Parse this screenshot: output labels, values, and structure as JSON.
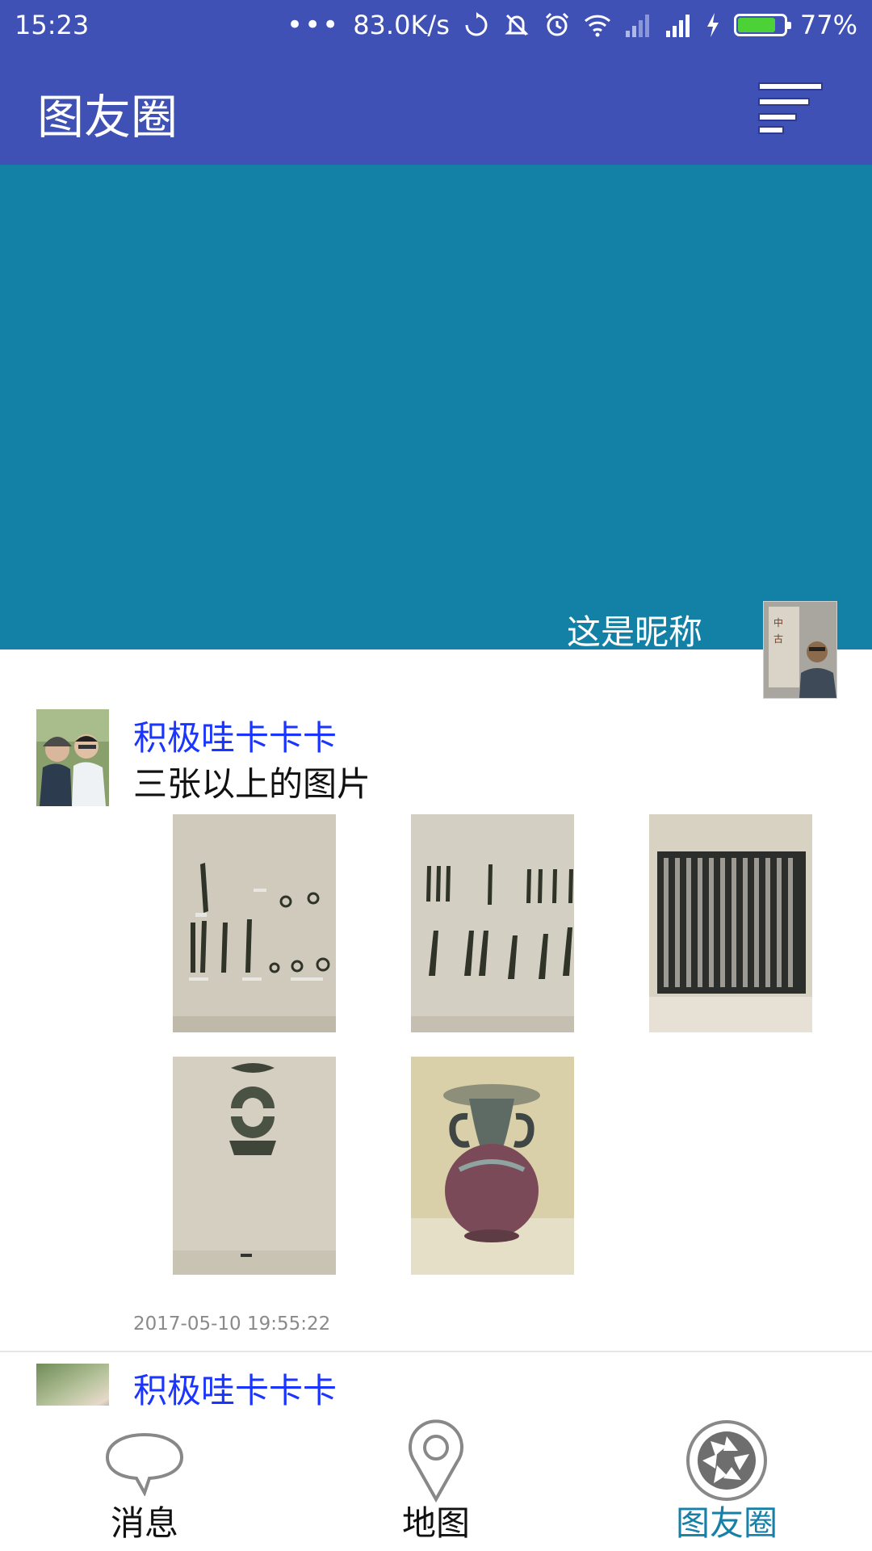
{
  "status_bar": {
    "time": "15:23",
    "dots": "•••",
    "net_speed": "83.0K/s",
    "battery_percent": "77%",
    "battery_level": 0.77
  },
  "app_bar": {
    "title": "图友圈",
    "filter_icon": "filter-list-icon"
  },
  "header": {
    "nickname": "这是昵称",
    "cover_color": "#1380a5"
  },
  "posts": [
    {
      "author": "积极哇卡卡卡",
      "text": "三张以上的图片",
      "timestamp": "2017-05-10 19:55:22",
      "photos": [
        "knife-coins-1",
        "knife-coins-2",
        "stele-rubbing",
        "jade-pieces",
        "purple-vase"
      ]
    },
    {
      "author": "积极哇卡卡卡"
    }
  ],
  "bottom_nav": {
    "items": [
      {
        "label": "消息",
        "icon": "chat-bubble-icon",
        "active": false
      },
      {
        "label": "地图",
        "icon": "map-pin-icon",
        "active": false
      },
      {
        "label": "图友圈",
        "icon": "camera-aperture-icon",
        "active": true
      }
    ],
    "active_color": "#1780a8"
  },
  "colors": {
    "primary": "#3f51b5",
    "author_name": "#1a35ff"
  }
}
